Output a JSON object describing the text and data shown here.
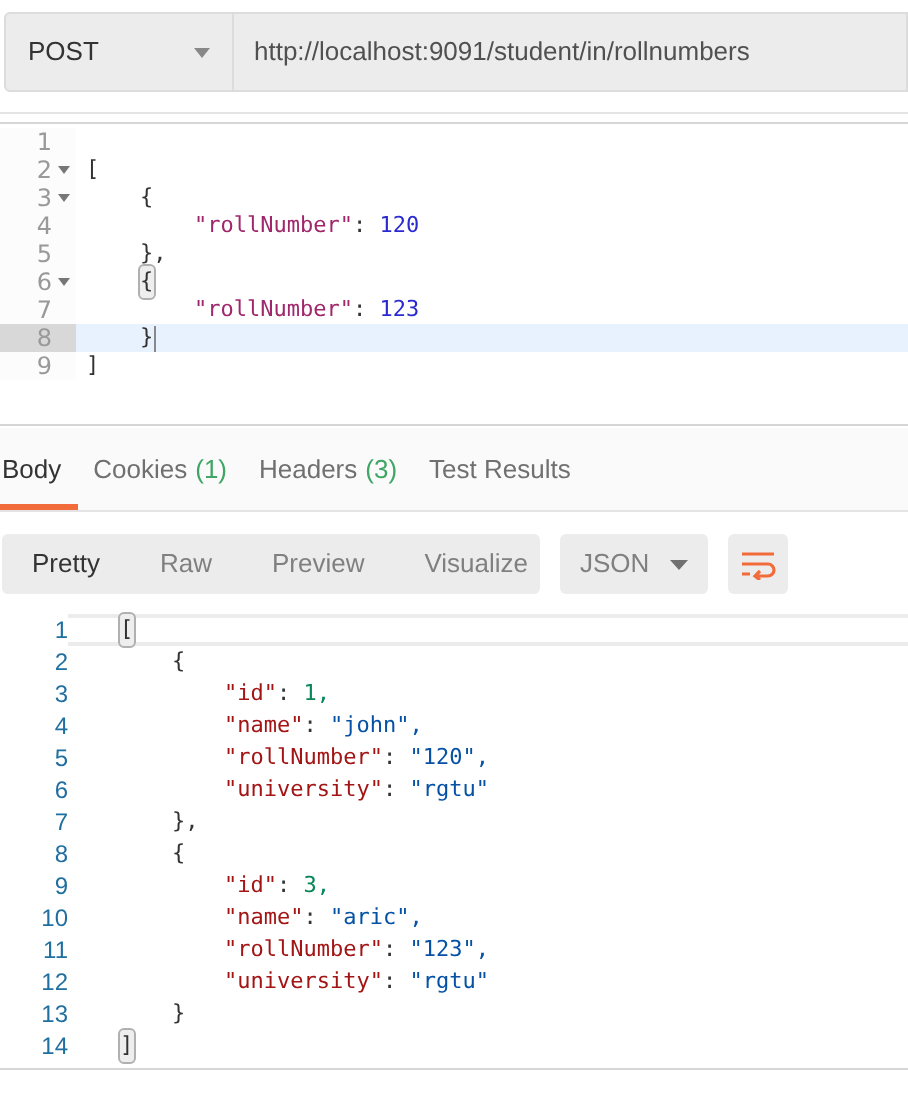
{
  "request": {
    "method": "POST",
    "url": "http://localhost:9091/student/in/rollnumbers"
  },
  "request_body": {
    "lines": [
      {
        "number": "1",
        "foldable": false,
        "selected": false
      },
      {
        "number": "2",
        "foldable": true,
        "selected": false,
        "tokens": [
          {
            "kind": "punct",
            "text": "["
          }
        ]
      },
      {
        "number": "3",
        "foldable": true,
        "selected": false,
        "tokens": [
          {
            "kind": "punct",
            "text": "{"
          }
        ]
      },
      {
        "number": "4",
        "foldable": false,
        "selected": false,
        "tokens": [
          {
            "kind": "key",
            "text": "\"rollNumber\""
          },
          {
            "kind": "punct",
            "text": ":"
          },
          {
            "kind": "number",
            "text": "120"
          }
        ]
      },
      {
        "number": "5",
        "foldable": false,
        "selected": false,
        "tokens": [
          {
            "kind": "punct",
            "text": "},"
          }
        ]
      },
      {
        "number": "6",
        "foldable": true,
        "selected": false,
        "tokens": [
          {
            "kind": "punct",
            "text": "{",
            "matched": true
          }
        ]
      },
      {
        "number": "7",
        "foldable": false,
        "selected": false,
        "tokens": [
          {
            "kind": "key",
            "text": "\"rollNumber\""
          },
          {
            "kind": "punct",
            "text": ":"
          },
          {
            "kind": "number",
            "text": "123"
          }
        ]
      },
      {
        "number": "8",
        "foldable": false,
        "selected": true,
        "tokens": [
          {
            "kind": "punct",
            "text": "}"
          }
        ]
      },
      {
        "number": "9",
        "foldable": false,
        "selected": false,
        "tokens": [
          {
            "kind": "punct",
            "text": "]"
          }
        ]
      }
    ]
  },
  "response_tabs": [
    {
      "label": "Body",
      "selected": true
    },
    {
      "label": "Cookies",
      "count": "(1)",
      "selected": false
    },
    {
      "label": "Headers",
      "count": "(3)",
      "selected": false
    },
    {
      "label": "Test Results",
      "selected": false
    }
  ],
  "view_modes": [
    {
      "label": "Pretty",
      "selected": true
    },
    {
      "label": "Raw",
      "selected": false
    },
    {
      "label": "Preview",
      "selected": false
    },
    {
      "label": "Visualize",
      "selected": false
    }
  ],
  "format": "JSON",
  "response_body": {
    "lines": [
      {
        "number": "1",
        "selected": true,
        "tokens": [
          {
            "kind": "punct",
            "text": "[",
            "matched": true
          }
        ]
      },
      {
        "number": "2",
        "selected": false,
        "tokens": [
          {
            "kind": "punct",
            "text": "{"
          }
        ]
      },
      {
        "number": "3",
        "selected": false,
        "tokens": [
          {
            "kind": "key",
            "text": "\"id\""
          },
          {
            "kind": "punct",
            "text": ":"
          },
          {
            "kind": "number",
            "text": "1,"
          }
        ]
      },
      {
        "number": "4",
        "selected": false,
        "tokens": [
          {
            "kind": "key",
            "text": "\"name\""
          },
          {
            "kind": "punct",
            "text": ":"
          },
          {
            "kind": "string",
            "text": "\"john\","
          }
        ]
      },
      {
        "number": "5",
        "selected": false,
        "tokens": [
          {
            "kind": "key",
            "text": "\"rollNumber\""
          },
          {
            "kind": "punct",
            "text": ":"
          },
          {
            "kind": "string",
            "text": "\"120\","
          }
        ]
      },
      {
        "number": "6",
        "selected": false,
        "tokens": [
          {
            "kind": "key",
            "text": "\"university\""
          },
          {
            "kind": "punct",
            "text": ":"
          },
          {
            "kind": "string",
            "text": "\"rgtu\""
          }
        ]
      },
      {
        "number": "7",
        "selected": false,
        "tokens": [
          {
            "kind": "punct",
            "text": "},"
          }
        ]
      },
      {
        "number": "8",
        "selected": false,
        "tokens": [
          {
            "kind": "punct",
            "text": "{"
          }
        ]
      },
      {
        "number": "9",
        "selected": false,
        "tokens": [
          {
            "kind": "key",
            "text": "\"id\""
          },
          {
            "kind": "punct",
            "text": ":"
          },
          {
            "kind": "number",
            "text": "3,"
          }
        ]
      },
      {
        "number": "10",
        "selected": false,
        "tokens": [
          {
            "kind": "key",
            "text": "\"name\""
          },
          {
            "kind": "punct",
            "text": ":"
          },
          {
            "kind": "string",
            "text": "\"aric\","
          }
        ]
      },
      {
        "number": "11",
        "selected": false,
        "tokens": [
          {
            "kind": "key",
            "text": "\"rollNumber\""
          },
          {
            "kind": "punct",
            "text": ":"
          },
          {
            "kind": "string",
            "text": "\"123\","
          }
        ]
      },
      {
        "number": "12",
        "selected": false,
        "tokens": [
          {
            "kind": "key",
            "text": "\"university\""
          },
          {
            "kind": "punct",
            "text": ":"
          },
          {
            "kind": "string",
            "text": "\"rgtu\""
          }
        ]
      },
      {
        "number": "13",
        "selected": false,
        "tokens": [
          {
            "kind": "punct",
            "text": "}"
          }
        ]
      },
      {
        "number": "14",
        "selected": false,
        "tokens": [
          {
            "kind": "punct",
            "text": "]",
            "matched": true
          }
        ]
      }
    ]
  }
}
